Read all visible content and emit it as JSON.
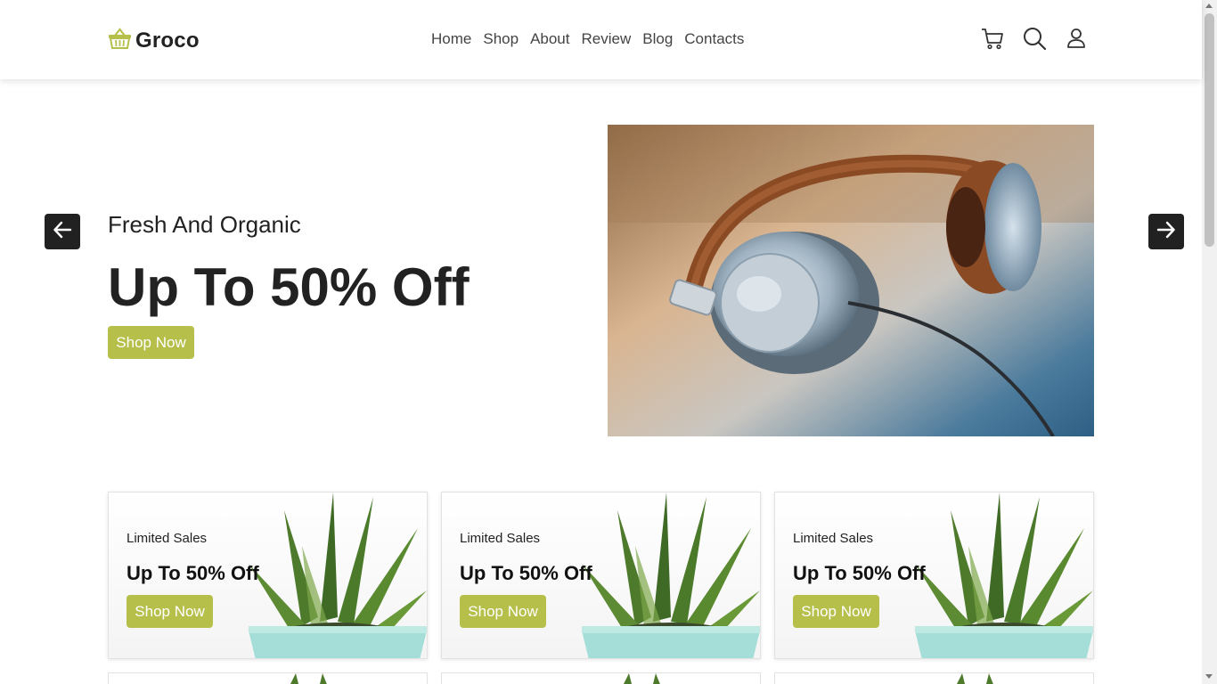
{
  "brand": {
    "name": "Groco",
    "logo_icon": "basket-icon",
    "accent": "#b6bf4a"
  },
  "nav": [
    "Home",
    "Shop",
    "About",
    "Review",
    "Blog",
    "Contacts"
  ],
  "header_icons": [
    "cart-icon",
    "search-icon",
    "user-icon"
  ],
  "hero": {
    "subtitle": "Fresh And Organic",
    "title": "Up To 50% Off",
    "button": "Shop Now",
    "prev_icon": "arrow-left-icon",
    "next_icon": "arrow-right-icon"
  },
  "cards": [
    {
      "subtitle": "Limited Sales",
      "title": "Up To 50% Off",
      "button": "Shop Now"
    },
    {
      "subtitle": "Limited Sales",
      "title": "Up To 50% Off",
      "button": "Shop Now"
    },
    {
      "subtitle": "Limited Sales",
      "title": "Up To 50% Off",
      "button": "Shop Now"
    }
  ]
}
